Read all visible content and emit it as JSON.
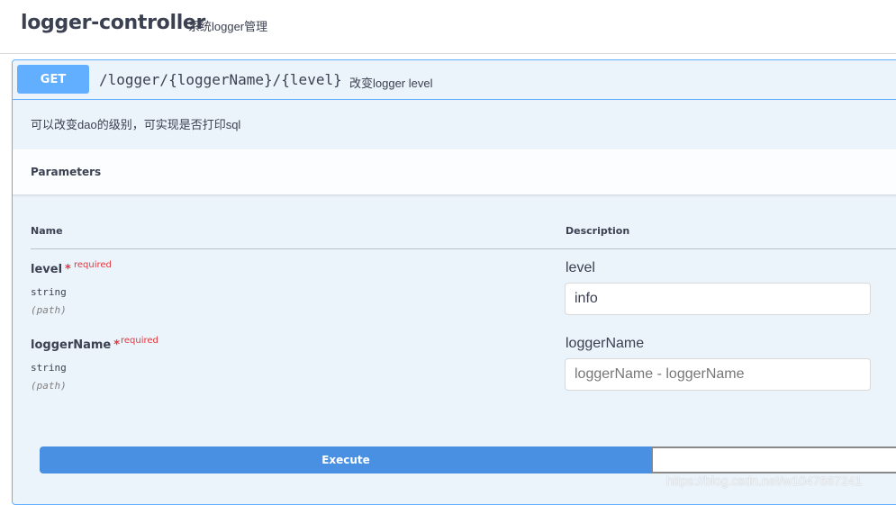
{
  "tag": {
    "title": "logger-controller",
    "description": "系统logger管理"
  },
  "operation": {
    "method": "GET",
    "path": "/logger/{loggerName}/{level}",
    "summary": "改变logger level",
    "description": "可以改变dao的级别，可实现是否打印sql"
  },
  "parameters": {
    "title": "Parameters",
    "columns": {
      "name": "Name",
      "description": "Description"
    },
    "items": [
      {
        "name": "level",
        "star": "*",
        "required_label": "required",
        "type": "string",
        "in": "(path)",
        "label": "level",
        "value": "info",
        "placeholder": ""
      },
      {
        "name": "loggerName",
        "star": "*",
        "required_label": "required",
        "type": "string",
        "in": "(path)",
        "label": "loggerName",
        "value": "",
        "placeholder": "loggerName - loggerName"
      }
    ]
  },
  "actions": {
    "execute_label": "Execute"
  },
  "watermark": "https://blog.csdn.net/w1047667241",
  "colors": {
    "get_accent": "#61affe",
    "execute": "#4990e2",
    "required": "#e0383e",
    "block_bg": "#ebf3fb"
  }
}
